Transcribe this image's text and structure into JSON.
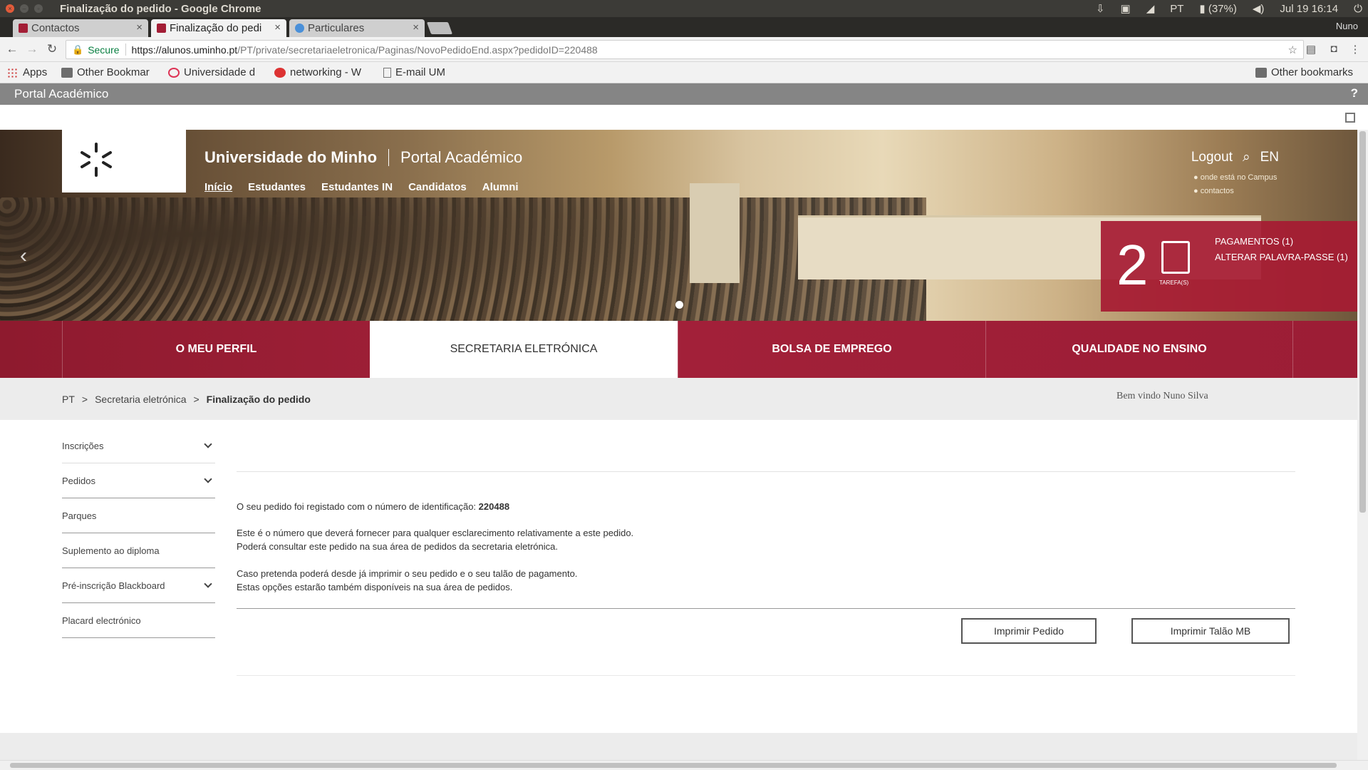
{
  "os": {
    "window_title": "Finalização do pedido - Google Chrome",
    "lang": "PT",
    "battery": "(37%)",
    "datetime": "Jul 19 16:14"
  },
  "tabs": [
    {
      "label": "Contactos",
      "close": "×"
    },
    {
      "label": "Finalização do pedi",
      "close": "×"
    },
    {
      "label": "Particulares",
      "close": "×"
    }
  ],
  "user_chip": "Nuno",
  "omnibox": {
    "secure_label": "Secure",
    "url_host": "https://alunos.uminho.pt",
    "url_path": "/PT/private/secretariaeletronica/Paginas/NovoPedidoEnd.aspx?pedidoID=220488"
  },
  "bookmarks": {
    "items": [
      "Apps",
      "Other Bookmar",
      "Universidade d",
      "networking - W",
      "E-mail UM"
    ],
    "other": "Other bookmarks"
  },
  "portal_strip": {
    "title": "Portal Académico",
    "help": "?"
  },
  "hero": {
    "uni_name": "Universidade do Minho",
    "portal_name": "Portal Académico",
    "nav": [
      "Início",
      "Estudantes",
      "Estudantes IN",
      "Candidatos",
      "Alumni"
    ],
    "logout": "Logout",
    "lang": "EN",
    "campus": "onde está no Campus",
    "contacts": "contactos"
  },
  "tasks": {
    "count": "2",
    "icon_label": "TAREFA(S)",
    "items": [
      "PAGAMENTOS (1)",
      "ALTERAR PALAVRA-PASSE (1)"
    ]
  },
  "band": [
    "O MEU PERFIL",
    "SECRETARIA ELETRÓNICA",
    "BOLSA DE EMPREGO",
    "QUALIDADE NO ENSINO"
  ],
  "breadcrumb": {
    "items": [
      "PT",
      "Secretaria eletrónica",
      "Finalização do pedido"
    ],
    "sep": ">",
    "welcome": "Bem vindo Nuno Silva"
  },
  "sidebar": [
    "Inscrições",
    "Pedidos",
    "Parques",
    "Suplemento ao diploma",
    "Pré-inscrição Blackboard",
    "Placard electrónico"
  ],
  "content": {
    "line1_text": "O seu pedido foi registado com o número de identificação:",
    "order_id": "220488",
    "line2": "Este é o número que deverá fornecer para qualquer esclarecimento relativamente a este pedido.",
    "line3": "Poderá consultar este pedido na sua área de pedidos da secretaria eletrónica.",
    "line4": "Caso pretenda poderá desde já imprimir o seu pedido e o seu talão de pagamento.",
    "line5": "Estas opções estarão também disponíveis na sua área de pedidos.",
    "btn_print_order": "Imprimir Pedido",
    "btn_print_mb": "Imprimir Talão MB"
  }
}
